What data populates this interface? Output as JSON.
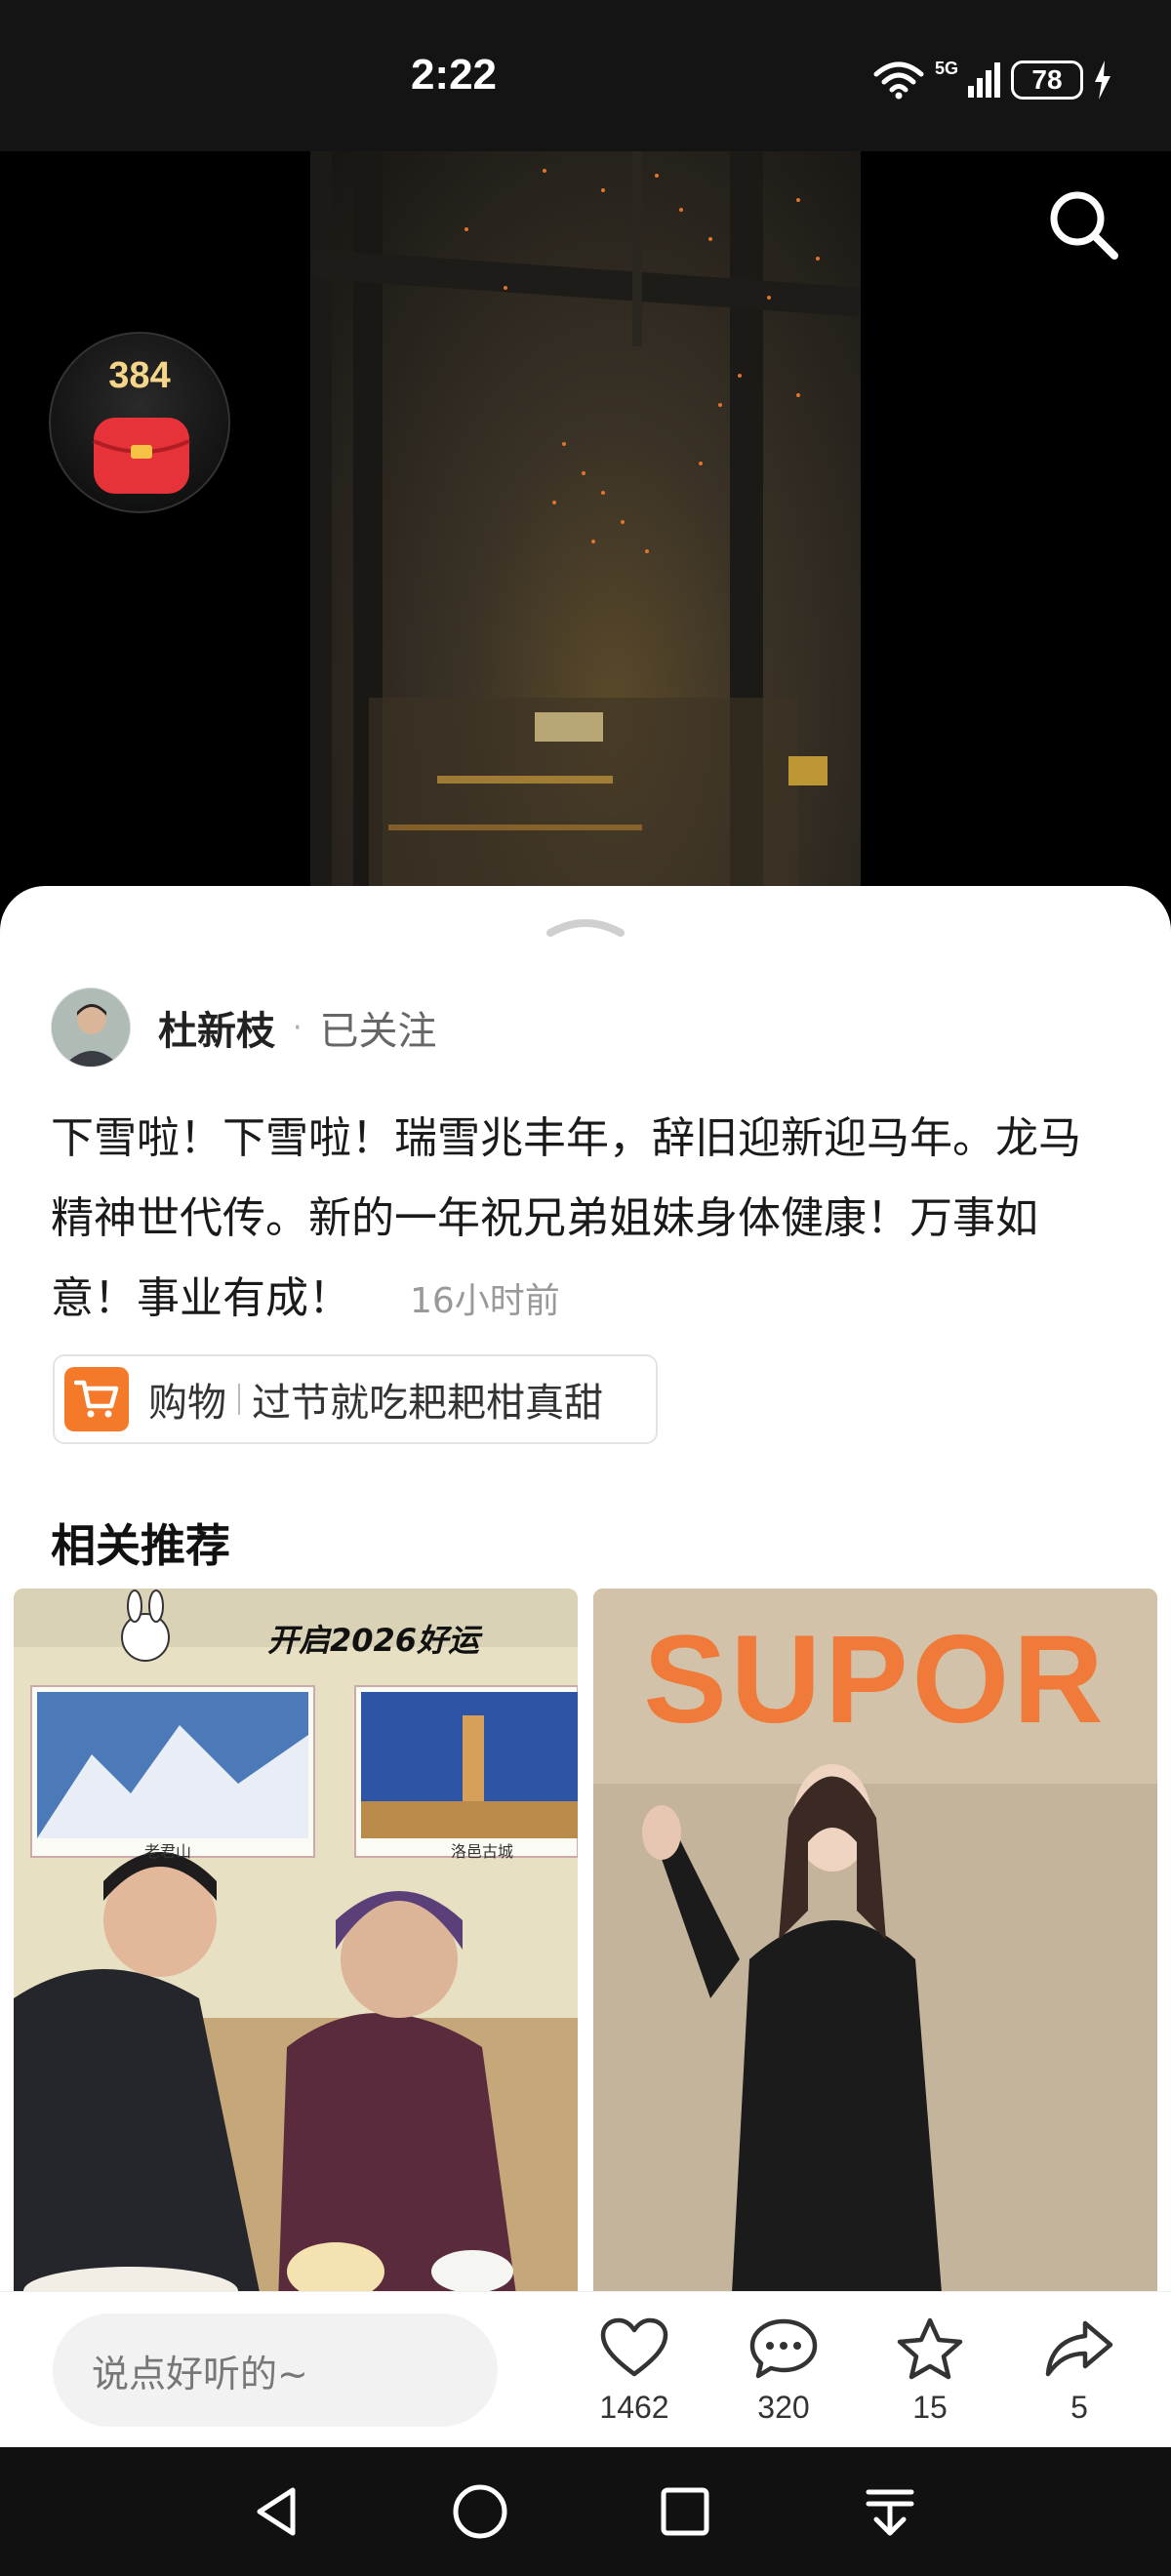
{
  "status_bar": {
    "time": "2:22",
    "network_label": "5G",
    "battery_level": "78",
    "icons": [
      "wifi-icon",
      "cellular-signal-icon",
      "battery-icon",
      "charging-icon"
    ]
  },
  "video": {
    "search_icon": "search-icon",
    "red_packet": {
      "count": "384",
      "icon": "red-packet-icon"
    }
  },
  "post": {
    "author": {
      "name": "杜新枝",
      "follow_status": "已关注"
    },
    "text": "下雪啦！下雪啦！瑞雪兆丰年，辞旧迎新迎马年。龙马精神世代传。新的一年祝兄弟姐妹身体健康！万事如意！事业有成！",
    "time": "16小时前",
    "shop_link": {
      "label": "购物",
      "title": "过节就吃耙耙柑真甜",
      "icon": "shopping-cart-icon"
    }
  },
  "recommendations": {
    "title": "相关推荐",
    "items": [
      {
        "overlay_text": "开启2026好运",
        "poster_labels": [
          "老君山",
          "洛邑古城"
        ]
      },
      {
        "wall_text": "SUPOR"
      }
    ]
  },
  "comment_bar": {
    "placeholder": "说点好听的~",
    "actions": [
      {
        "name": "like",
        "icon": "heart-icon",
        "count": "1462"
      },
      {
        "name": "comment",
        "icon": "comment-icon",
        "count": "320"
      },
      {
        "name": "favorite",
        "icon": "star-icon",
        "count": "15"
      },
      {
        "name": "share",
        "icon": "share-icon",
        "count": "5"
      }
    ]
  },
  "nav_bar": {
    "buttons": [
      "back-icon",
      "home-icon",
      "recents-icon",
      "menu-down-icon"
    ]
  },
  "colors": {
    "accent_orange": "#f47a2a",
    "red_packet": "#e8323a",
    "sheet_background": "#ffffff",
    "status_bar_background": "#141414"
  }
}
